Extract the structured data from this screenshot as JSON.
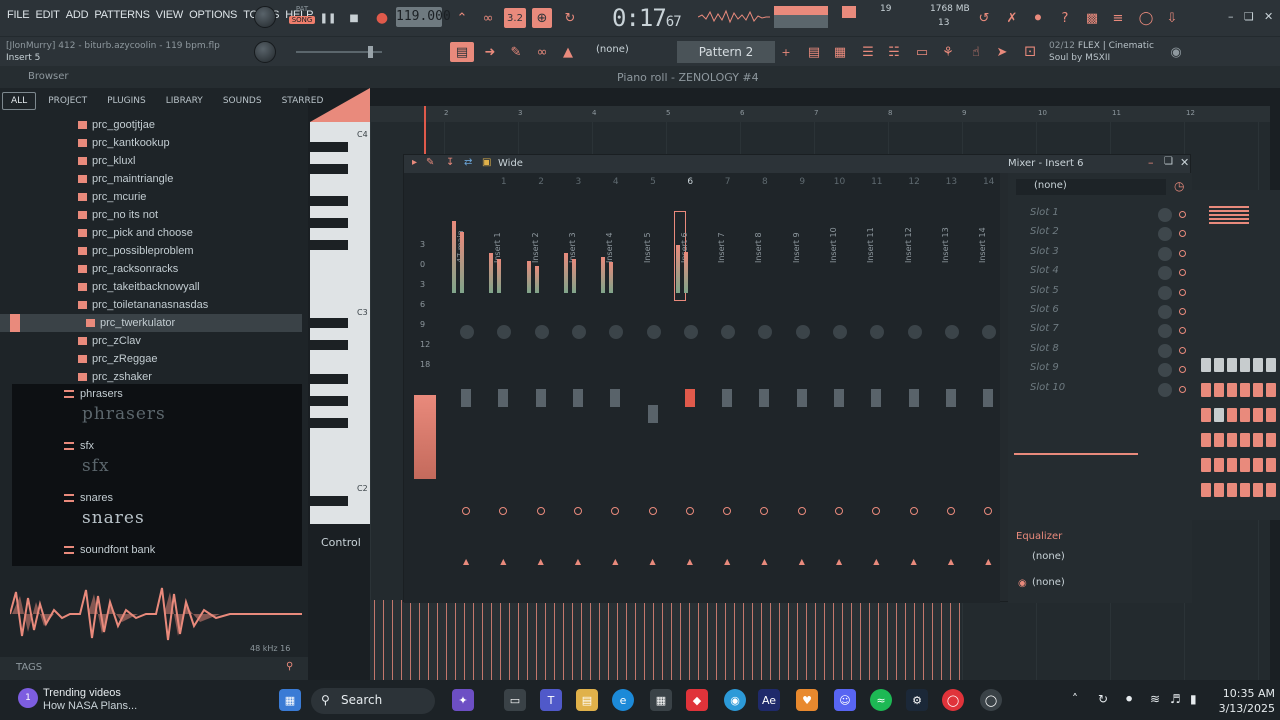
{
  "menu": [
    "FILE",
    "EDIT",
    "ADD",
    "PATTERNS",
    "VIEW",
    "OPTIONS",
    "TOOLS",
    "HELP"
  ],
  "transport": {
    "pat_label": "PAT",
    "song_label": "SONG",
    "tempo": "119.000",
    "time_main": "0:17",
    "time_sub": "67",
    "step": "3.2"
  },
  "cpu": {
    "voices": "19",
    "memory": "1768 MB",
    "cores": "13"
  },
  "project": {
    "file": "[JlonMurry] 412 - biturb.azycoolin - 119 bpm.flp",
    "insert": "Insert 5"
  },
  "pattern": {
    "none_label": "(none)",
    "name": "Pattern 2"
  },
  "hint": {
    "counter": "02/12",
    "text1": "FLEX | Cinematic",
    "text2": "Soul by MSXII"
  },
  "browser": {
    "title": "Browser",
    "tabs": [
      "ALL",
      "PROJECT",
      "PLUGINS",
      "LIBRARY",
      "SOUNDS",
      "STARRED"
    ],
    "files": [
      "prc_gootjtjae",
      "prc_kantkookup",
      "prc_kluxl",
      "prc_maintriangle",
      "prc_mcurie",
      "prc_no its not",
      "prc_pick and choose",
      "prc_possibleproblem",
      "prc_racksonracks",
      "prc_takeitbacknowyall",
      "prc_toiletananasnasdas",
      "prc_twerkulator",
      "prc_zClav",
      "prc_zReggae",
      "prc_zshaker"
    ],
    "selected_file": "prc_twerkulator",
    "folders": [
      {
        "name": "phrasers",
        "art": "phrasers"
      },
      {
        "name": "sfx",
        "art": "sfx"
      },
      {
        "name": "snares",
        "art": "snares"
      },
      {
        "name": "soundfont bank",
        "art": ""
      }
    ],
    "sample_rate": "48 kHz 16",
    "tags_label": "TAGS"
  },
  "piano_roll": {
    "title": "Piano roll - ZENOLOGY #4",
    "ruler": [
      "2",
      "3",
      "4",
      "5",
      "6",
      "7",
      "8",
      "9",
      "10",
      "11",
      "12"
    ],
    "key_labels": [
      "C4",
      "C3",
      "C2"
    ],
    "control_label": "Control"
  },
  "mixer": {
    "mode": "Wide",
    "title": "Mixer - Insert 6",
    "scale": [
      "3",
      "0",
      "3",
      "6",
      "9",
      "12",
      "18"
    ],
    "strips": [
      {
        "num": "",
        "name": "47 main",
        "level": 0.9
      },
      {
        "num": "1",
        "name": "Insert 1",
        "level": 0.5
      },
      {
        "num": "2",
        "name": "Insert 2",
        "level": 0.4
      },
      {
        "num": "3",
        "name": "Insert 3",
        "level": 0.5
      },
      {
        "num": "4",
        "name": "Insert 4",
        "level": 0.45
      },
      {
        "num": "5",
        "name": "Insert 5",
        "level": 0.0
      },
      {
        "num": "6",
        "name": "Insert 6",
        "level": 0.6
      },
      {
        "num": "7",
        "name": "Insert 7",
        "level": 0.0
      },
      {
        "num": "8",
        "name": "Insert 8",
        "level": 0.0
      },
      {
        "num": "9",
        "name": "Insert 9",
        "level": 0.0
      },
      {
        "num": "10",
        "name": "Insert 10",
        "level": 0.0
      },
      {
        "num": "11",
        "name": "Insert 11",
        "level": 0.0
      },
      {
        "num": "12",
        "name": "Insert 12",
        "level": 0.0
      },
      {
        "num": "13",
        "name": "Insert 13",
        "level": 0.0
      },
      {
        "num": "14",
        "name": "Insert 14",
        "level": 0.0
      }
    ],
    "selected_strip": "6",
    "insert_none": "(none)",
    "slots": [
      "Slot 1",
      "Slot 2",
      "Slot 3",
      "Slot 4",
      "Slot 5",
      "Slot 6",
      "Slot 7",
      "Slot 8",
      "Slot 9",
      "Slot 10"
    ],
    "eq_label": "Equalizer",
    "send1": "(none)",
    "send2": "(none)"
  },
  "taskbar": {
    "news_title": "Trending videos",
    "news_sub": "How NASA Plans...",
    "news_badge": "1",
    "search": "Search",
    "time": "10:35 AM",
    "date": "3/13/2025"
  },
  "colors": {
    "accent": "#e98a7c",
    "panel": "#242a2e",
    "bar": "#2c3338"
  }
}
